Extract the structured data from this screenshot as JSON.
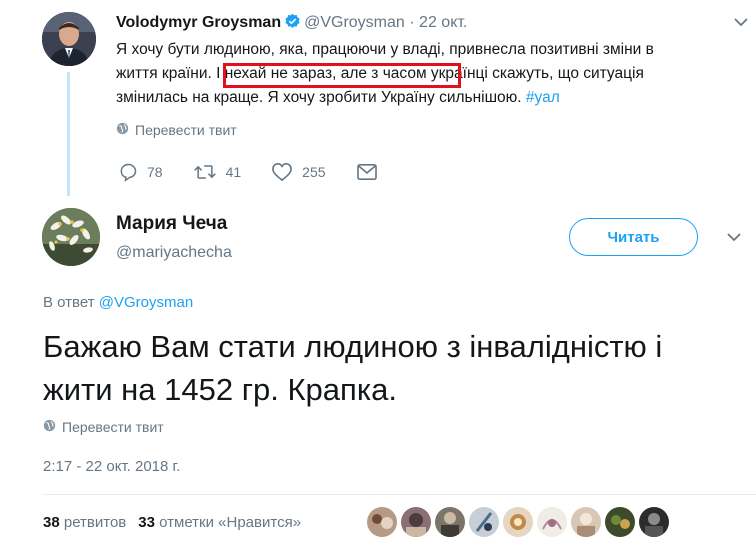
{
  "tweet1": {
    "name": "Volodymyr Groysman",
    "handle": "@VGroysman",
    "date": "22 окт.",
    "separator": "·",
    "text_line1": "Я хочу бути людиною, яка, працюючи у владі, привнесла позитивні зміни в",
    "text_line2": "життя країни. І нехай не зараз, але з часом українці скажуть, що ситуація",
    "text_line3": "змінилась на краще. Я хочу зробити Україну сильнішою.",
    "hashtag": "#уал",
    "translate": "Перевести твит",
    "replies": "78",
    "retweets": "41",
    "likes": "255"
  },
  "tweet2": {
    "name": "Мария Чеча",
    "handle": "@mariyachecha",
    "follow_label": "Читать",
    "reply_prefix": "В ответ",
    "reply_mention": "@VGroysman",
    "text_line1": "Бажаю Вам стати людиною з інвалідністю і",
    "text_line2": "жити на 1452 гр. Крапка.",
    "translate": "Перевести твит",
    "timestamp": "2:17 - 22 окт. 2018 г.",
    "retweet_count": "38",
    "retweet_label": "ретвитов",
    "like_count": "33",
    "like_label": "отметки «Нравится»"
  },
  "colors": {
    "accent": "#1da1f2",
    "muted": "#657786",
    "highlight_box": "#e0111c",
    "thread_line": "#c4e4f7"
  },
  "icons": [
    "verified-badge-icon",
    "globe-icon",
    "reply-icon",
    "retweet-icon",
    "heart-icon",
    "dm-icon",
    "chevron-down-icon"
  ]
}
